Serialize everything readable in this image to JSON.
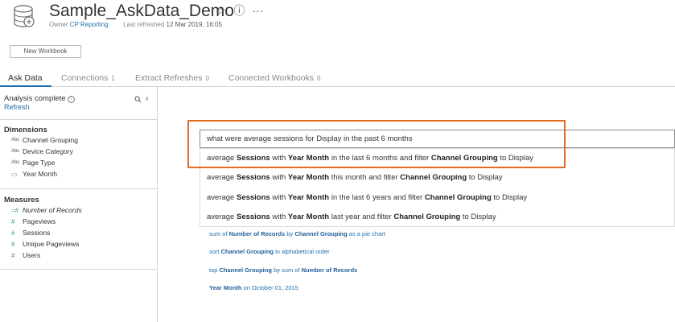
{
  "header": {
    "title": "Sample_AskData_Demo",
    "owner_label": "Owner",
    "owner": "CP Reporting",
    "refreshed_label": "Last refreshed",
    "refreshed": "12 Mar 2019, 16:05",
    "star_glyph": "☆",
    "info_glyph": "ⓘ",
    "more_glyph": "···"
  },
  "toolbar": {
    "new_workbook": "New Workbook"
  },
  "tabs": [
    {
      "label": "Ask Data",
      "count": ""
    },
    {
      "label": "Connections",
      "count": "1"
    },
    {
      "label": "Extract Refreshes",
      "count": "0"
    },
    {
      "label": "Connected Workbooks",
      "count": "0"
    }
  ],
  "sidebar": {
    "status": "Analysis complete",
    "refresh": "Refresh",
    "dimensions_title": "Dimensions",
    "dimensions": [
      {
        "icon": "Abc",
        "label": "Channel Grouping"
      },
      {
        "icon": "Abc",
        "label": "Device Category"
      },
      {
        "icon": "Abc",
        "label": "Page Type"
      },
      {
        "icon": "▭",
        "label": "Year Month"
      }
    ],
    "measures_title": "Measures",
    "measures": [
      {
        "icon": "=#",
        "label": "Number of Records"
      },
      {
        "icon": "#",
        "label": "Pageviews"
      },
      {
        "icon": "#",
        "label": "Sessions"
      },
      {
        "icon": "#",
        "label": "Unique Pageviews"
      },
      {
        "icon": "#",
        "label": "Users"
      }
    ]
  },
  "query": {
    "text": "what were average sessions for Display in the past 6 months"
  },
  "suggestions": [
    {
      "parts": [
        "average ",
        "Sessions",
        " with ",
        "Year Month",
        " in the last 6 months and filter ",
        "Channel Grouping",
        " to Display"
      ]
    },
    {
      "parts": [
        "average ",
        "Sessions",
        " with ",
        "Year Month",
        " this month and filter ",
        "Channel Grouping",
        " to Display"
      ]
    },
    {
      "parts": [
        "average ",
        "Sessions",
        " with ",
        "Year Month",
        " in the last 6 years and filter ",
        "Channel Grouping",
        " to Display"
      ]
    },
    {
      "parts": [
        "average ",
        "Sessions",
        " with ",
        "Year Month",
        " last year and filter ",
        "Channel Grouping",
        " to Display"
      ]
    }
  ],
  "hints": [
    {
      "parts": [
        "sum of ",
        "Number of Records",
        " by ",
        "Channel Grouping",
        " as a pie chart"
      ]
    },
    {
      "parts": [
        "sort ",
        "Channel Grouping",
        " in alphabetical order"
      ]
    },
    {
      "parts": [
        "top ",
        "Channel Grouping",
        " by sum of ",
        "Number of Records"
      ]
    },
    {
      "parts": [
        "Year Month",
        " on October 01, 2015"
      ]
    }
  ],
  "colors": {
    "accent": "#1f6fad",
    "highlight": "#e46c1f"
  }
}
